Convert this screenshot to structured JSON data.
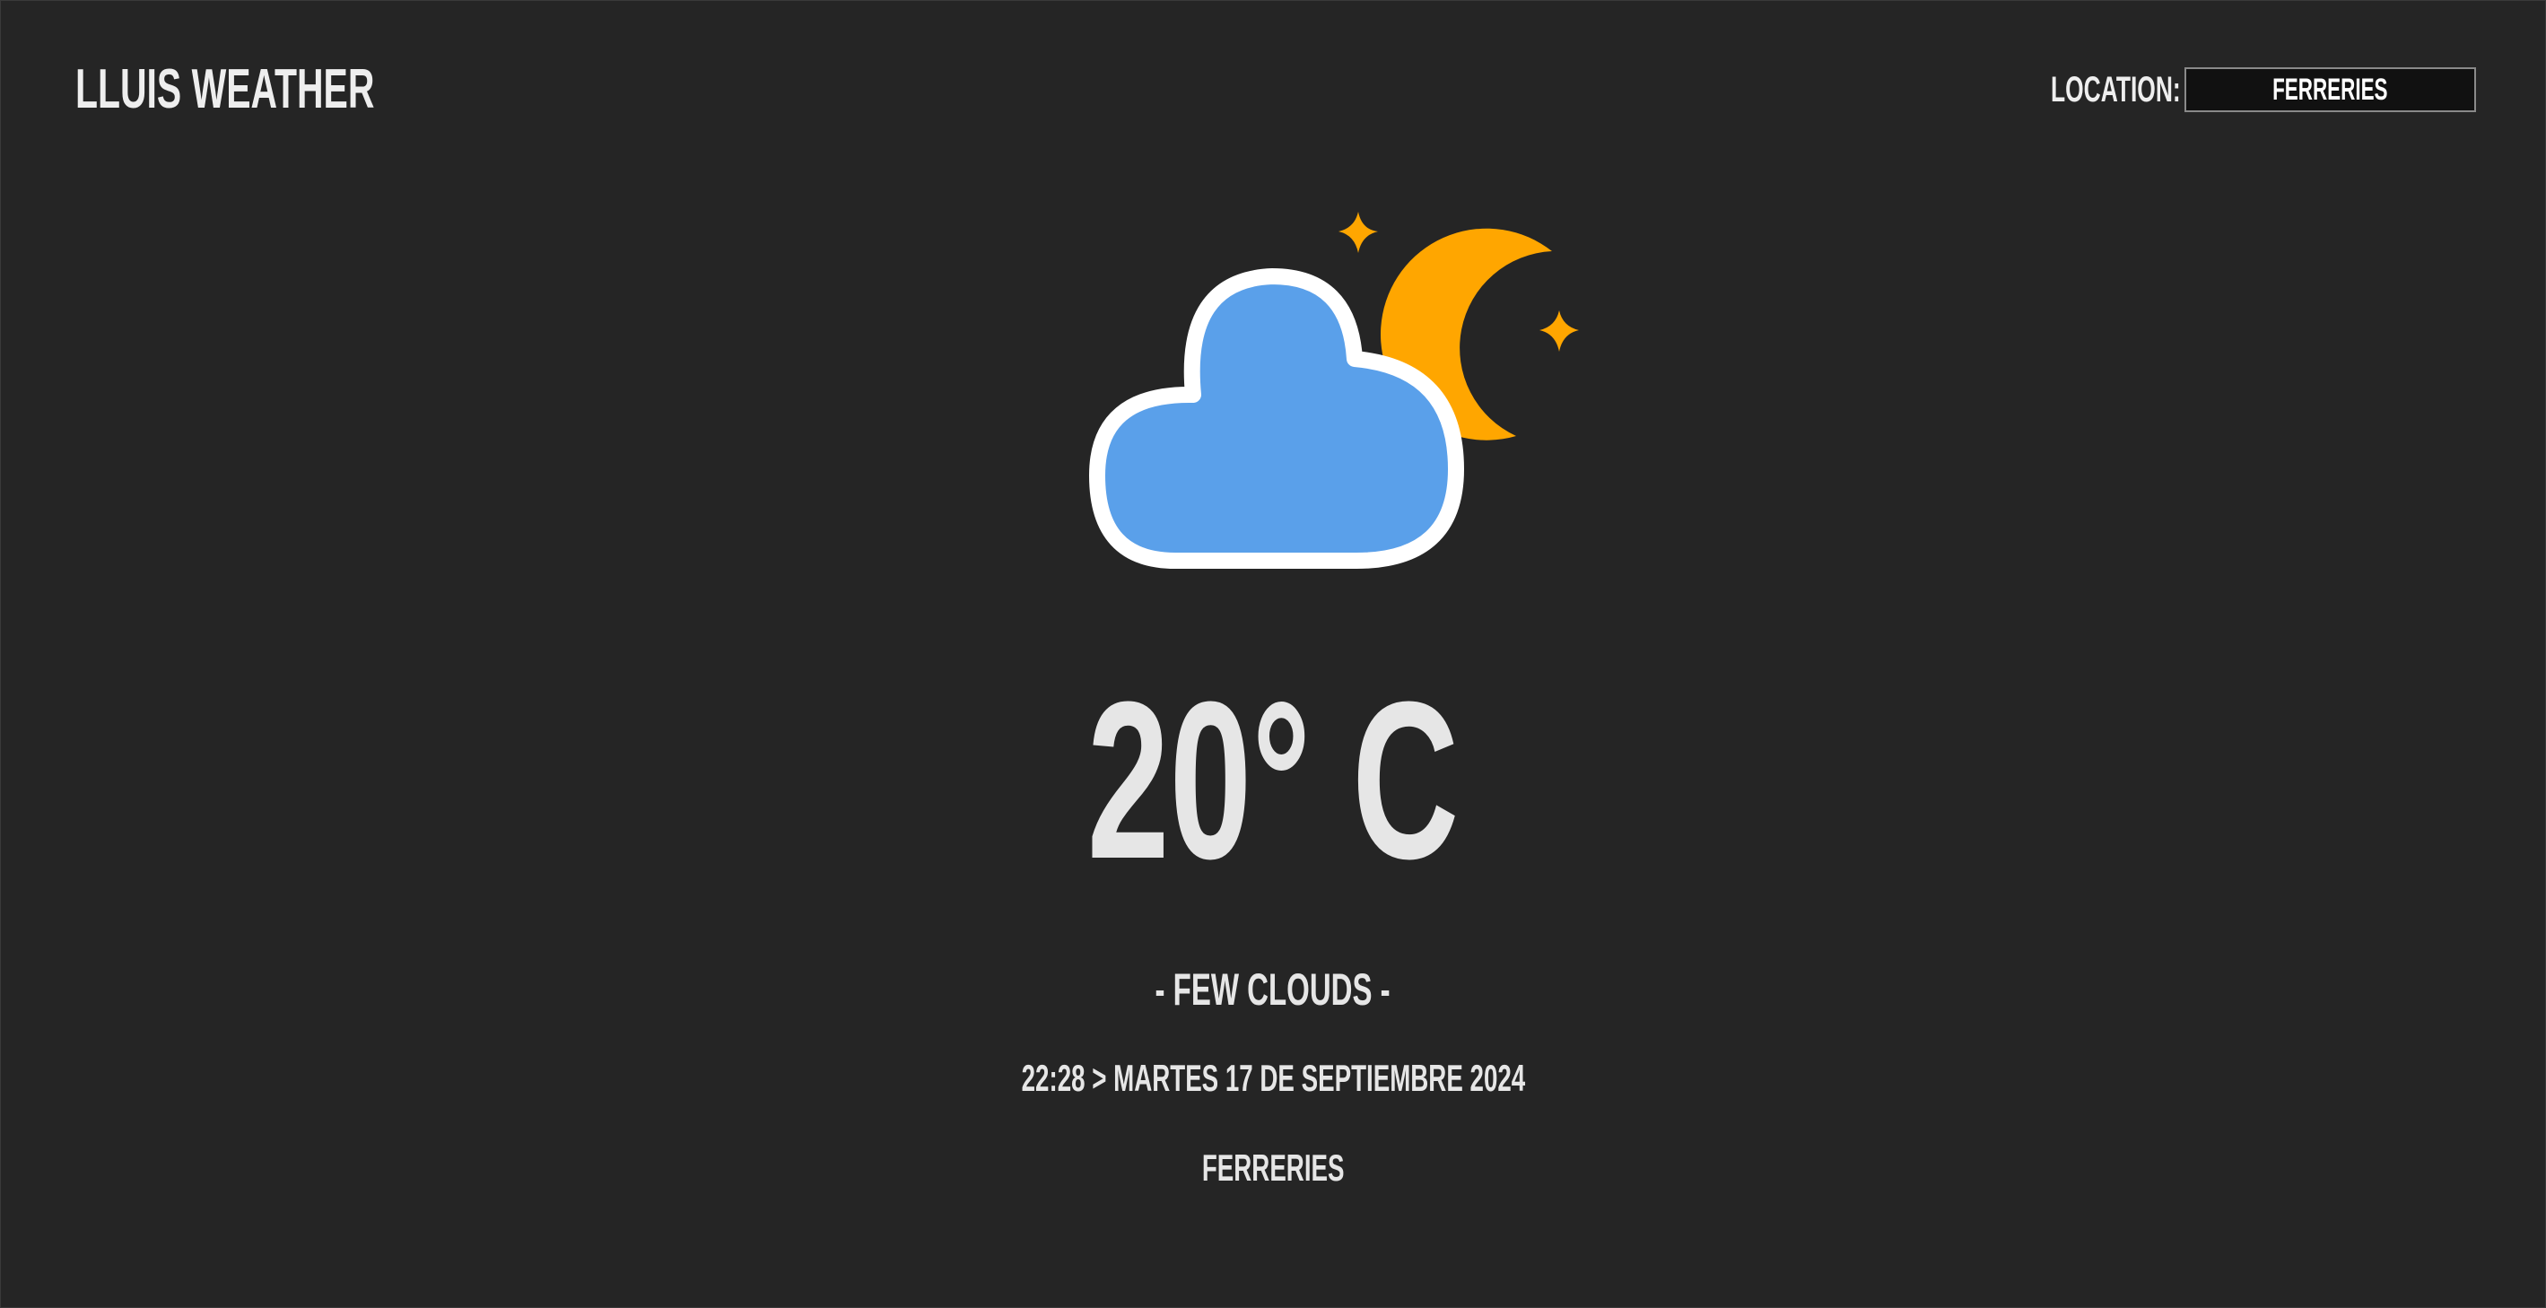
{
  "header": {
    "app_title": "LLUIS WEATHER",
    "location_label": "LOCATION:",
    "location_value": "FERRERIES"
  },
  "weather": {
    "icon": "partly-cloudy-night-icon",
    "temperature": "20° C",
    "description": "- FEW CLOUDS -",
    "datetime": "22:28 > MARTES 17 DE SEPTIEMBRE 2024",
    "city": "FERRERIES"
  },
  "colors": {
    "background": "#252525",
    "cloud": "#5aa0ea",
    "moon": "#ffa600",
    "text": "#e6e6e6"
  }
}
